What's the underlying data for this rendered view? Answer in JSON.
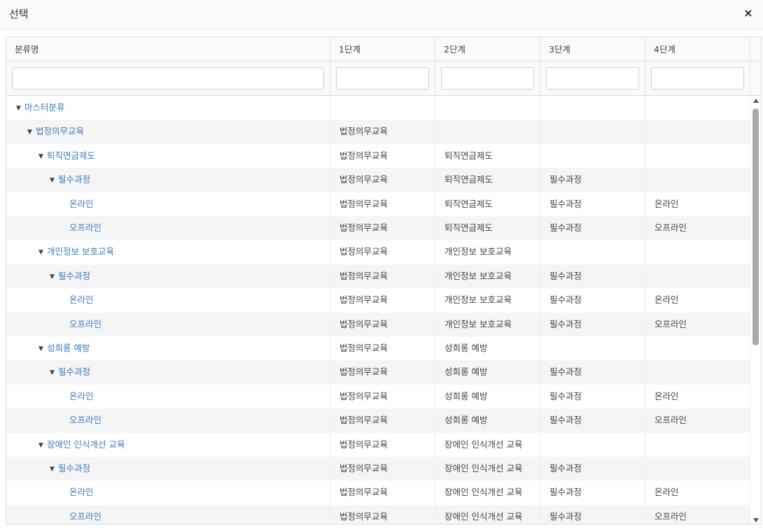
{
  "dialog": {
    "title": "선택",
    "close_icon": "×"
  },
  "columns": [
    "분류명",
    "1단계",
    "2단계",
    "3단계",
    "4단계"
  ],
  "rows": [
    {
      "level": 0,
      "expanded": true,
      "name": "마스터분류",
      "s1": "",
      "s2": "",
      "s3": "",
      "s4": ""
    },
    {
      "level": 1,
      "expanded": true,
      "name": "법정의무교육",
      "s1": "법정의무교육",
      "s2": "",
      "s3": "",
      "s4": ""
    },
    {
      "level": 2,
      "expanded": true,
      "name": "퇴직연금제도",
      "s1": "법정의무교육",
      "s2": "퇴직연금제도",
      "s3": "",
      "s4": ""
    },
    {
      "level": 3,
      "expanded": true,
      "name": "필수과정",
      "s1": "법정의무교육",
      "s2": "퇴직연금제도",
      "s3": "필수과정",
      "s4": ""
    },
    {
      "level": 4,
      "expanded": null,
      "name": "온라인",
      "s1": "법정의무교육",
      "s2": "퇴직연금제도",
      "s3": "필수과정",
      "s4": "온라인"
    },
    {
      "level": 4,
      "expanded": null,
      "name": "오프라인",
      "s1": "법정의무교육",
      "s2": "퇴직연금제도",
      "s3": "필수과정",
      "s4": "오프라인"
    },
    {
      "level": 2,
      "expanded": true,
      "name": "개인정보 보호교육",
      "s1": "법정의무교육",
      "s2": "개인정보 보호교육",
      "s3": "",
      "s4": ""
    },
    {
      "level": 3,
      "expanded": true,
      "name": "필수과정",
      "s1": "법정의무교육",
      "s2": "개인정보 보호교육",
      "s3": "필수과정",
      "s4": ""
    },
    {
      "level": 4,
      "expanded": null,
      "name": "온라인",
      "s1": "법정의무교육",
      "s2": "개인정보 보호교육",
      "s3": "필수과정",
      "s4": "온라인"
    },
    {
      "level": 4,
      "expanded": null,
      "name": "오프라인",
      "s1": "법정의무교육",
      "s2": "개인정보 보호교육",
      "s3": "필수과정",
      "s4": "오프라인"
    },
    {
      "level": 2,
      "expanded": true,
      "name": "성희롱 예방",
      "s1": "법정의무교육",
      "s2": "성희롱 예방",
      "s3": "",
      "s4": ""
    },
    {
      "level": 3,
      "expanded": true,
      "name": "필수과정",
      "s1": "법정의무교육",
      "s2": "성희롱 예방",
      "s3": "필수과정",
      "s4": ""
    },
    {
      "level": 4,
      "expanded": null,
      "name": "온라인",
      "s1": "법정의무교육",
      "s2": "성희롱 예방",
      "s3": "필수과정",
      "s4": "온라인"
    },
    {
      "level": 4,
      "expanded": null,
      "name": "오프라인",
      "s1": "법정의무교육",
      "s2": "성희롱 예방",
      "s3": "필수과정",
      "s4": "오프라인"
    },
    {
      "level": 2,
      "expanded": true,
      "name": "장애인 인식개선 교육",
      "s1": "법정의무교육",
      "s2": "장애인 인식개선 교육",
      "s3": "",
      "s4": ""
    },
    {
      "level": 3,
      "expanded": true,
      "name": "필수과정",
      "s1": "법정의무교육",
      "s2": "장애인 인식개선 교육",
      "s3": "필수과정",
      "s4": ""
    },
    {
      "level": 4,
      "expanded": null,
      "name": "온라인",
      "s1": "법정의무교육",
      "s2": "장애인 인식개선 교육",
      "s3": "필수과정",
      "s4": "온라인"
    },
    {
      "level": 4,
      "expanded": null,
      "name": "오프라인",
      "s1": "법정의무교육",
      "s2": "장애인 인식개선 교육",
      "s3": "필수과정",
      "s4": "오프라인"
    }
  ],
  "colors": {
    "link": "#3c7ab8",
    "alt_row": "#f5f5f5",
    "header_bg": "#fafafa"
  }
}
